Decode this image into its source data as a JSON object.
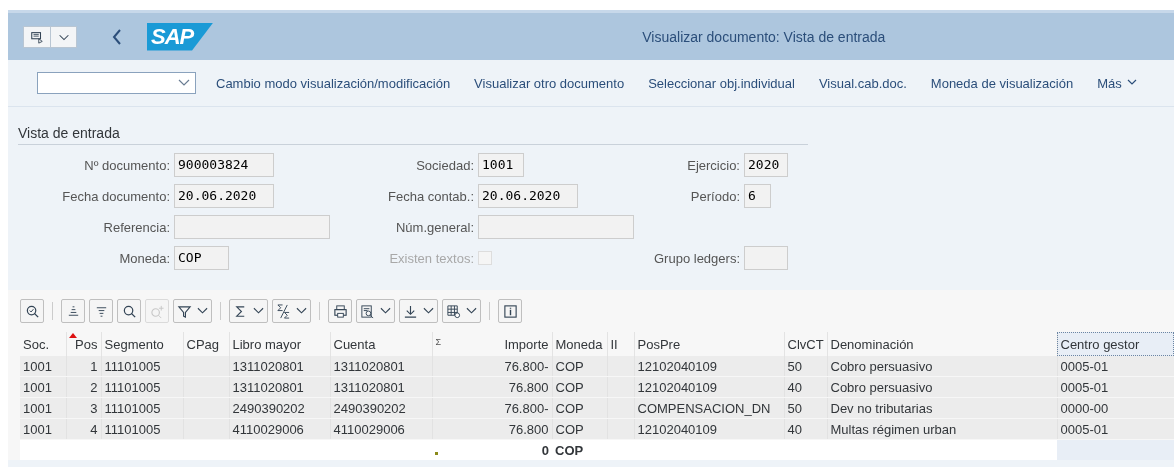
{
  "header": {
    "logo": "SAP",
    "title": "Visualizar documento: Vista de entrada"
  },
  "toolbar": {
    "items": [
      "Cambio modo visualización/modificación",
      "Visualizar otro documento",
      "Seleccionar obj.individual",
      "Visual.cab.doc.",
      "Moneda de visualización"
    ],
    "more": "Más"
  },
  "form": {
    "title": "Vista de entrada",
    "rows": [
      [
        {
          "label": "Nº documento:",
          "kind": "field",
          "value": "900003824"
        },
        {
          "label": "Sociedad:",
          "kind": "field",
          "value": "1001"
        },
        {
          "label": "Ejercicio:",
          "kind": "field",
          "value": "2020"
        }
      ],
      [
        {
          "label": "Fecha documento:",
          "kind": "field",
          "value": "20.06.2020"
        },
        {
          "label": "Fecha contab.:",
          "kind": "field",
          "value": "20.06.2020"
        },
        {
          "label": "Período:",
          "kind": "field",
          "value": "6"
        }
      ],
      [
        {
          "label": "Referencia:",
          "kind": "field"
        },
        {
          "label": "Núm.general:",
          "kind": "field"
        },
        null
      ],
      [
        {
          "label": "Moneda:",
          "kind": "field",
          "value": "COP"
        },
        {
          "label": "Existen textos:",
          "kind": "checkbox",
          "checked": false,
          "disabled": true
        },
        {
          "label": "Grupo ledgers:",
          "kind": "field"
        }
      ]
    ]
  },
  "grid_toolbar": {
    "groups": [
      [
        {
          "kind": "details",
          "dropdown": false,
          "disabled": false
        }
      ],
      [
        {
          "kind": "sort_up",
          "dropdown": false,
          "disabled": false
        },
        {
          "kind": "sort_down",
          "dropdown": false,
          "disabled": false
        },
        {
          "kind": "search",
          "dropdown": false,
          "disabled": false
        },
        {
          "kind": "search_next",
          "dropdown": false,
          "disabled": true
        },
        {
          "kind": "filter",
          "dropdown": true,
          "disabled": false
        }
      ],
      [
        {
          "kind": "sum",
          "dropdown": true,
          "disabled": false
        },
        {
          "kind": "subtotal",
          "dropdown": true,
          "disabled": false
        }
      ],
      [
        {
          "kind": "print",
          "dropdown": false,
          "disabled": false
        },
        {
          "kind": "view",
          "dropdown": true,
          "disabled": false
        },
        {
          "kind": "export",
          "dropdown": true,
          "disabled": false
        },
        {
          "kind": "layout",
          "dropdown": true,
          "disabled": false
        }
      ],
      [
        {
          "kind": "info",
          "dropdown": false,
          "disabled": false
        }
      ]
    ]
  },
  "table": {
    "columns": [
      {
        "label": "Soc.",
        "sorted": false,
        "selected": false
      },
      {
        "label": "Pos",
        "sorted": true,
        "selected": false
      },
      {
        "label": "Segmento",
        "sorted": false,
        "selected": false
      },
      {
        "label": "CPag",
        "sorted": false,
        "selected": false
      },
      {
        "label": "Libro mayor",
        "sorted": false,
        "selected": false
      },
      {
        "label": "Cuenta",
        "sorted": false,
        "selected": false
      },
      {
        "label": "Importe",
        "sum_mark": "Σ",
        "sorted": false,
        "selected": false
      },
      {
        "label": "Moneda",
        "sorted": false,
        "selected": false
      },
      {
        "label": "II",
        "sorted": false,
        "selected": false
      },
      {
        "label": "PosPre",
        "sorted": false,
        "selected": false
      },
      {
        "label": "ClvCT",
        "sorted": false,
        "selected": false
      },
      {
        "label": "Denominación",
        "sorted": false,
        "selected": false
      },
      {
        "label": "Centro gestor",
        "sorted": false,
        "selected": true
      }
    ],
    "rows": [
      [
        "1001",
        "1",
        "11101005",
        null,
        "1311020801",
        "1311020801",
        "76.800-",
        "COP",
        null,
        "12102040109",
        "50",
        "Cobro persuasivo",
        "0005-01"
      ],
      [
        "1001",
        "2",
        "11101005",
        null,
        "1311020801",
        "1311020801",
        "76.800",
        "COP",
        null,
        "12102040109",
        "40",
        "Cobro persuasivo",
        "0005-01"
      ],
      [
        "1001",
        "3",
        "11101005",
        null,
        "2490390202",
        "2490390202",
        "76.800-",
        "COP",
        null,
        "COMPENSACION_DN",
        "50",
        "Dev no tributarias",
        "0000-00"
      ],
      [
        "1001",
        "4",
        "11101005",
        null,
        "4110029006",
        "4110029006",
        "76.800",
        "COP",
        null,
        "12102040109",
        "40",
        "Multas régimen urban",
        "0005-01"
      ]
    ],
    "total": {
      "amount": "0",
      "currency": "COP"
    }
  }
}
